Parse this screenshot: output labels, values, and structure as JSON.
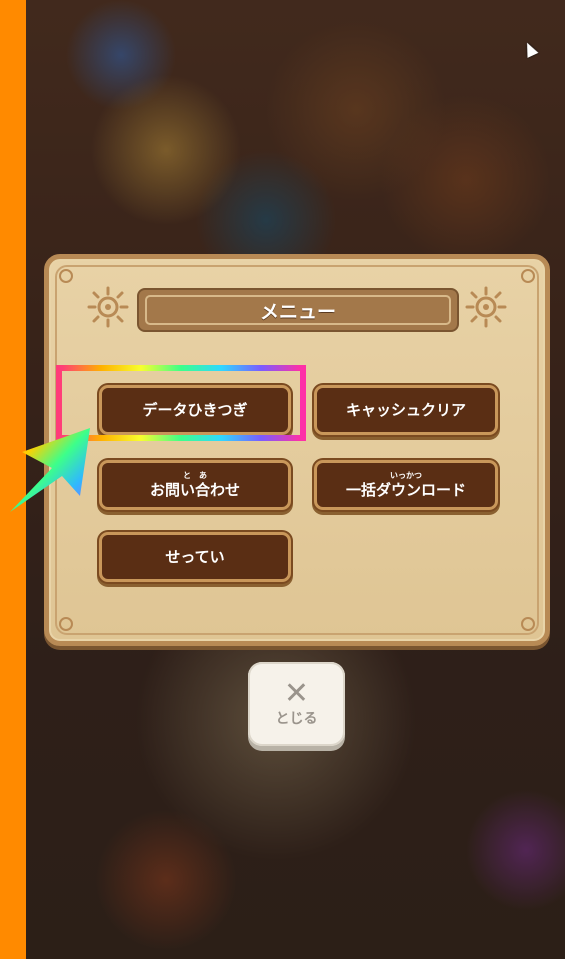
{
  "menu": {
    "title": "メニュー",
    "buttons": [
      {
        "label": "データひきつぎ",
        "ruby": ""
      },
      {
        "label": "キャッシュクリア",
        "ruby": ""
      },
      {
        "label": "お問い合わせ",
        "ruby": "と　あ"
      },
      {
        "label": "一括ダウンロード",
        "ruby": "いっかつ"
      },
      {
        "label": "せってい",
        "ruby": ""
      }
    ]
  },
  "close": {
    "icon": "close-icon",
    "label": "とじる"
  },
  "colors": {
    "accent_strip": "#ff8a00",
    "button_fill": "#5a2e14",
    "panel_fill": "#e8d2a6",
    "highlight": "#ff2fa6"
  }
}
